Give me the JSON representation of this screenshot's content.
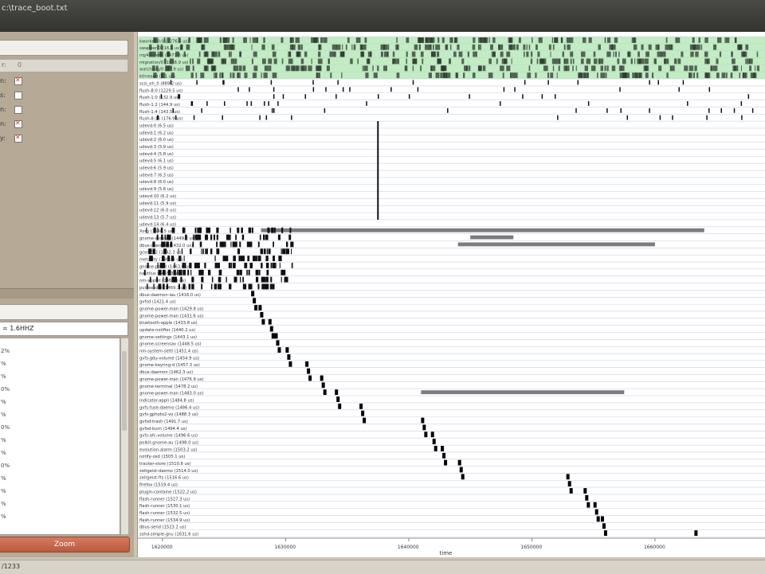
{
  "window": {
    "title": "c:\\trace_boot.txt"
  },
  "left_panel": {
    "combo_label": "r:",
    "combo_value": "0",
    "options": [
      {
        "label": "n:",
        "checked": true
      },
      {
        "label": "s:",
        "checked": false
      },
      {
        "label": "n:",
        "checked": false
      },
      {
        "label": "n:",
        "checked": true
      },
      {
        "label": "y:",
        "checked": true
      }
    ],
    "frequency": "= 1.6HHZ",
    "zoom_label": "Zoom",
    "list_items": [
      "2%",
      "%",
      "%",
      "0%",
      "%",
      "%",
      "0%",
      "%",
      "%",
      "0%",
      "%",
      "%",
      "%",
      "%"
    ]
  },
  "chart_data": {
    "type": "scatter",
    "xlabel": "time",
    "x_ticks": [
      "1620000",
      "1630000",
      "1640000",
      "1650000",
      "1660000"
    ],
    "colors": {
      "bar_green": "#8fdc8f",
      "row_line": "#c8d0e6",
      "event": "#111111"
    },
    "process_labels": [
      "kworker/0:0 (1276.6 us)",
      "swapper/0 (16.8 us)",
      "irq/49-mmc (3471.8 us)",
      "migration/0 (1038.9 us)",
      "watchdog/0 (27.9 us)",
      "kthreadd (2.1 us)",
      "scsi_eh_0 (889.2 us)",
      "flush-8:0 (1229.5 us)",
      "flush-1:0 (132.9 us)",
      "flush-1:2 (144.9 us)",
      "flush-1:4 (143.5 us)",
      "flush-8:16 (176.9 us)",
      "udevd:0 (6.5 us)",
      "udevd:1 (6.2 us)",
      "udevd:2 (6.0 us)",
      "udevd:3 (5.9 us)",
      "udevd:4 (5.8 us)",
      "udevd:5 (6.1 us)",
      "udevd:6 (5.9 us)",
      "udevd:7 (6.3 us)",
      "udevd:8 (6.0 us)",
      "udevd:9 (5.8 us)",
      "udevd:10 (6.2 us)",
      "udevd:11 (5.9 us)",
      "udevd:12 (6.0 us)",
      "udevd:13 (5.7 us)",
      "udevd:14 (6.4 us)",
      "Xorg (1640.5 us)",
      "gnome-session (1449.2 us)",
      "dbus-daemon (1432.0 us)",
      "gconfd-2 (1442.3 us)",
      "metacity (1461.4 us)",
      "gnome-panel (1463.6 us)",
      "nautilus (1465.3 us)",
      "nm-applet (1467.6 us)",
      "pulseaudio (1469.3 us)",
      "dbus-daemon-lau (1416.0 us)",
      "gvfsd (1421.4 us)",
      "gnome-power-man (1429.8 us)",
      "gnome-power-man (1431.6 us)",
      "bluetooth-apple (1433.8 us)",
      "update-notifier (1440.2 us)",
      "gnome-settings (1443.1 us)",
      "gnome-screensav (1448.5 us)",
      "nm-system-setti (1451.4 us)",
      "gvfs-gdu-volume (1454.9 us)",
      "gnome-keyring-d (1457.3 us)",
      "dbus-daemon (1462.3 us)",
      "gnome-power-man (1476.9 us)",
      "gnome-terminal (1478.2 us)",
      "gnome-power-man (1483.0 us)",
      "indicator-appli (1484.8 us)",
      "gvfs-fuse-daemo (1486.4 us)",
      "gvfs-gphoto2-vo (1488.3 us)",
      "gvfsd-trash (1491.7 us)",
      "gvfsd-burn (1494.4 us)",
      "gvfs-afc-volume (1496.6 us)",
      "polkit-gnome-au (1498.0 us)",
      "evolution-alarm (1503.2 us)",
      "notify-osd (1505.1 us)",
      "tracker-store (1510.8 us)",
      "zeitgeist-daemo (1514.0 us)",
      "zeitgeist-fts (1516.6 us)",
      "firefox (1519.4 us)",
      "plugin-containe (1522.2 us)",
      "flash-runner (1527.3 us)",
      "flash-runner (1530.1 us)",
      "flash-runner (1532.5 us)",
      "flash-runner (1534.9 us)",
      "dbus-send (1523.2 us)",
      "sshd-simple-gnu (1631.6 us)"
    ],
    "green_rows": 6,
    "diagonal_bursts": [
      {
        "row": 36,
        "x": 1627200
      },
      {
        "row": 38,
        "x": 1627800
      },
      {
        "row": 40,
        "x": 1628600
      },
      {
        "row": 42,
        "x": 1629100
      },
      {
        "row": 44,
        "x": 1630000
      },
      {
        "row": 46,
        "x": 1631600
      },
      {
        "row": 48,
        "x": 1632800
      },
      {
        "row": 50,
        "x": 1634000
      },
      {
        "row": 52,
        "x": 1636000
      },
      {
        "row": 54,
        "x": 1641000
      },
      {
        "row": 56,
        "x": 1641800
      },
      {
        "row": 58,
        "x": 1642600
      },
      {
        "row": 60,
        "x": 1644000
      },
      {
        "row": 62,
        "x": 1652800
      },
      {
        "row": 64,
        "x": 1654200
      },
      {
        "row": 66,
        "x": 1655000
      },
      {
        "row": 68,
        "x": 1655600
      },
      {
        "row": 70,
        "x": 1663200
      }
    ],
    "long_bars": [
      {
        "row": 27,
        "x0": 1628000,
        "x1": 1664000
      },
      {
        "row": 28,
        "x0": 1645000,
        "x1": 1648500
      },
      {
        "row": 29,
        "x0": 1644000,
        "x1": 1660000
      },
      {
        "row": 50,
        "x0": 1641000,
        "x1": 1657500
      }
    ],
    "vertical_marker": {
      "x": 1637500,
      "row0": 12,
      "row1": 26
    }
  },
  "status": {
    "text": "/1233"
  }
}
